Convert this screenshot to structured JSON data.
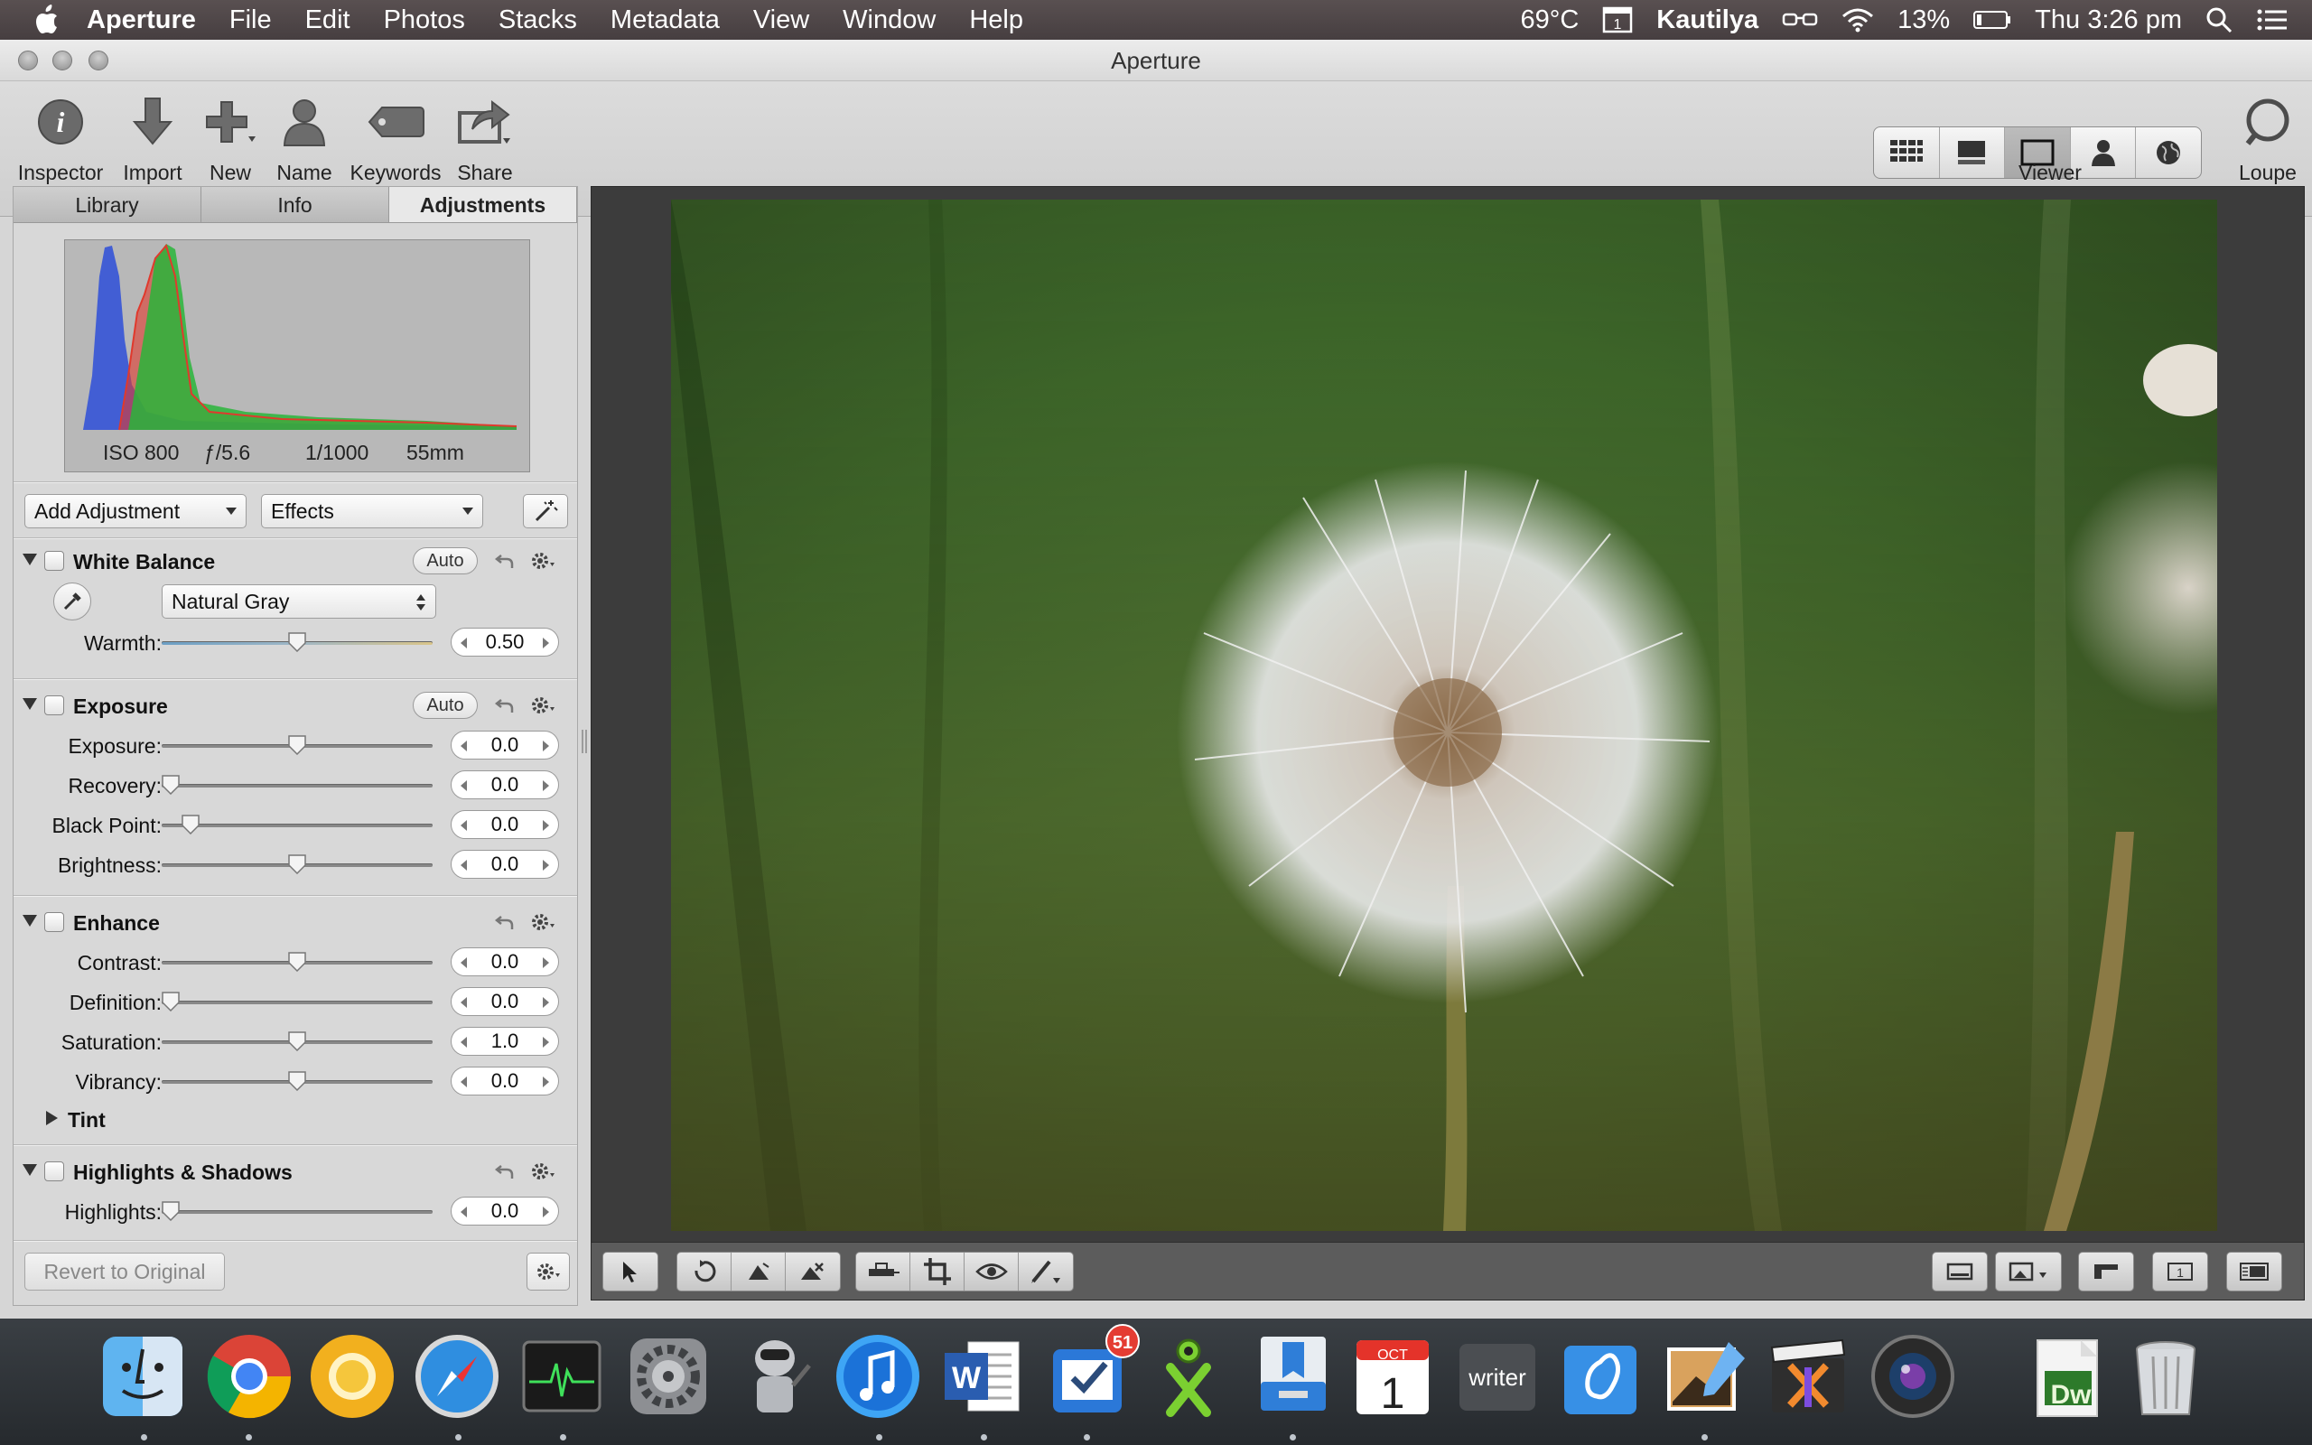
{
  "menubar": {
    "app_name": "Aperture",
    "menus": [
      "File",
      "Edit",
      "Photos",
      "Stacks",
      "Metadata",
      "View",
      "Window",
      "Help"
    ],
    "status": {
      "temperature": "69°C",
      "user": "Kautilya",
      "battery": "13%",
      "clock": "Thu 3:26 pm"
    }
  },
  "window": {
    "title": "Aperture"
  },
  "toolbar": {
    "inspector": "Inspector",
    "import": "Import",
    "new": "New",
    "name": "Name",
    "keywords": "Keywords",
    "share": "Share",
    "viewer": "Viewer",
    "loupe": "Loupe"
  },
  "tabs": [
    "Library",
    "Info",
    "Adjustments"
  ],
  "histogram": {
    "iso": "ISO 800",
    "aperture": "ƒ/5.6",
    "shutter": "1/1000",
    "focal": "55mm"
  },
  "adjust_controls": {
    "add_adjustment": "Add Adjustment",
    "effects": "Effects"
  },
  "white_balance": {
    "title": "White Balance",
    "auto": "Auto",
    "mode": "Natural Gray",
    "warmth_label": "Warmth:",
    "warmth_value": "0.50",
    "warmth_level": 0.5
  },
  "exposure": {
    "title": "Exposure",
    "auto": "Auto",
    "rows": [
      {
        "label": "Exposure:",
        "value": "0.0",
        "level": 0.5
      },
      {
        "label": "Recovery:",
        "value": "0.0",
        "level": 0.0
      },
      {
        "label": "Black Point:",
        "value": "0.0",
        "level": 0.08
      },
      {
        "label": "Brightness:",
        "value": "0.0",
        "level": 0.5
      }
    ]
  },
  "enhance": {
    "title": "Enhance",
    "rows": [
      {
        "label": "Contrast:",
        "value": "0.0",
        "level": 0.5
      },
      {
        "label": "Definition:",
        "value": "0.0",
        "level": 0.0
      },
      {
        "label": "Saturation:",
        "value": "1.0",
        "level": 0.5
      },
      {
        "label": "Vibrancy:",
        "value": "0.0",
        "level": 0.5
      }
    ],
    "tint": "Tint"
  },
  "highlights_shadows": {
    "title": "Highlights & Shadows",
    "rows": [
      {
        "label": "Highlights:",
        "value": "0.0",
        "level": 0.0
      }
    ]
  },
  "revert_button": "Revert to Original",
  "dock": {
    "apps": [
      "finder-icon",
      "chrome-icon",
      "chrome-canary-icon",
      "safari-icon",
      "activity-monitor-icon",
      "system-preferences-icon",
      "automator-icon",
      "itunes-icon",
      "word-icon",
      "things-icon",
      "ocr-icon",
      "preview-icon",
      "calendar-icon",
      "writer-icon",
      "pages-icon",
      "aperture-icon",
      "final-cut-icon",
      "photo-booth-icon",
      "dreamweaver-icon",
      "trash-icon"
    ],
    "badge_count": "51",
    "calendar_month": "OCT",
    "calendar_day": "1",
    "writer_label": "writer",
    "dreamweaver_label": "Dw"
  }
}
